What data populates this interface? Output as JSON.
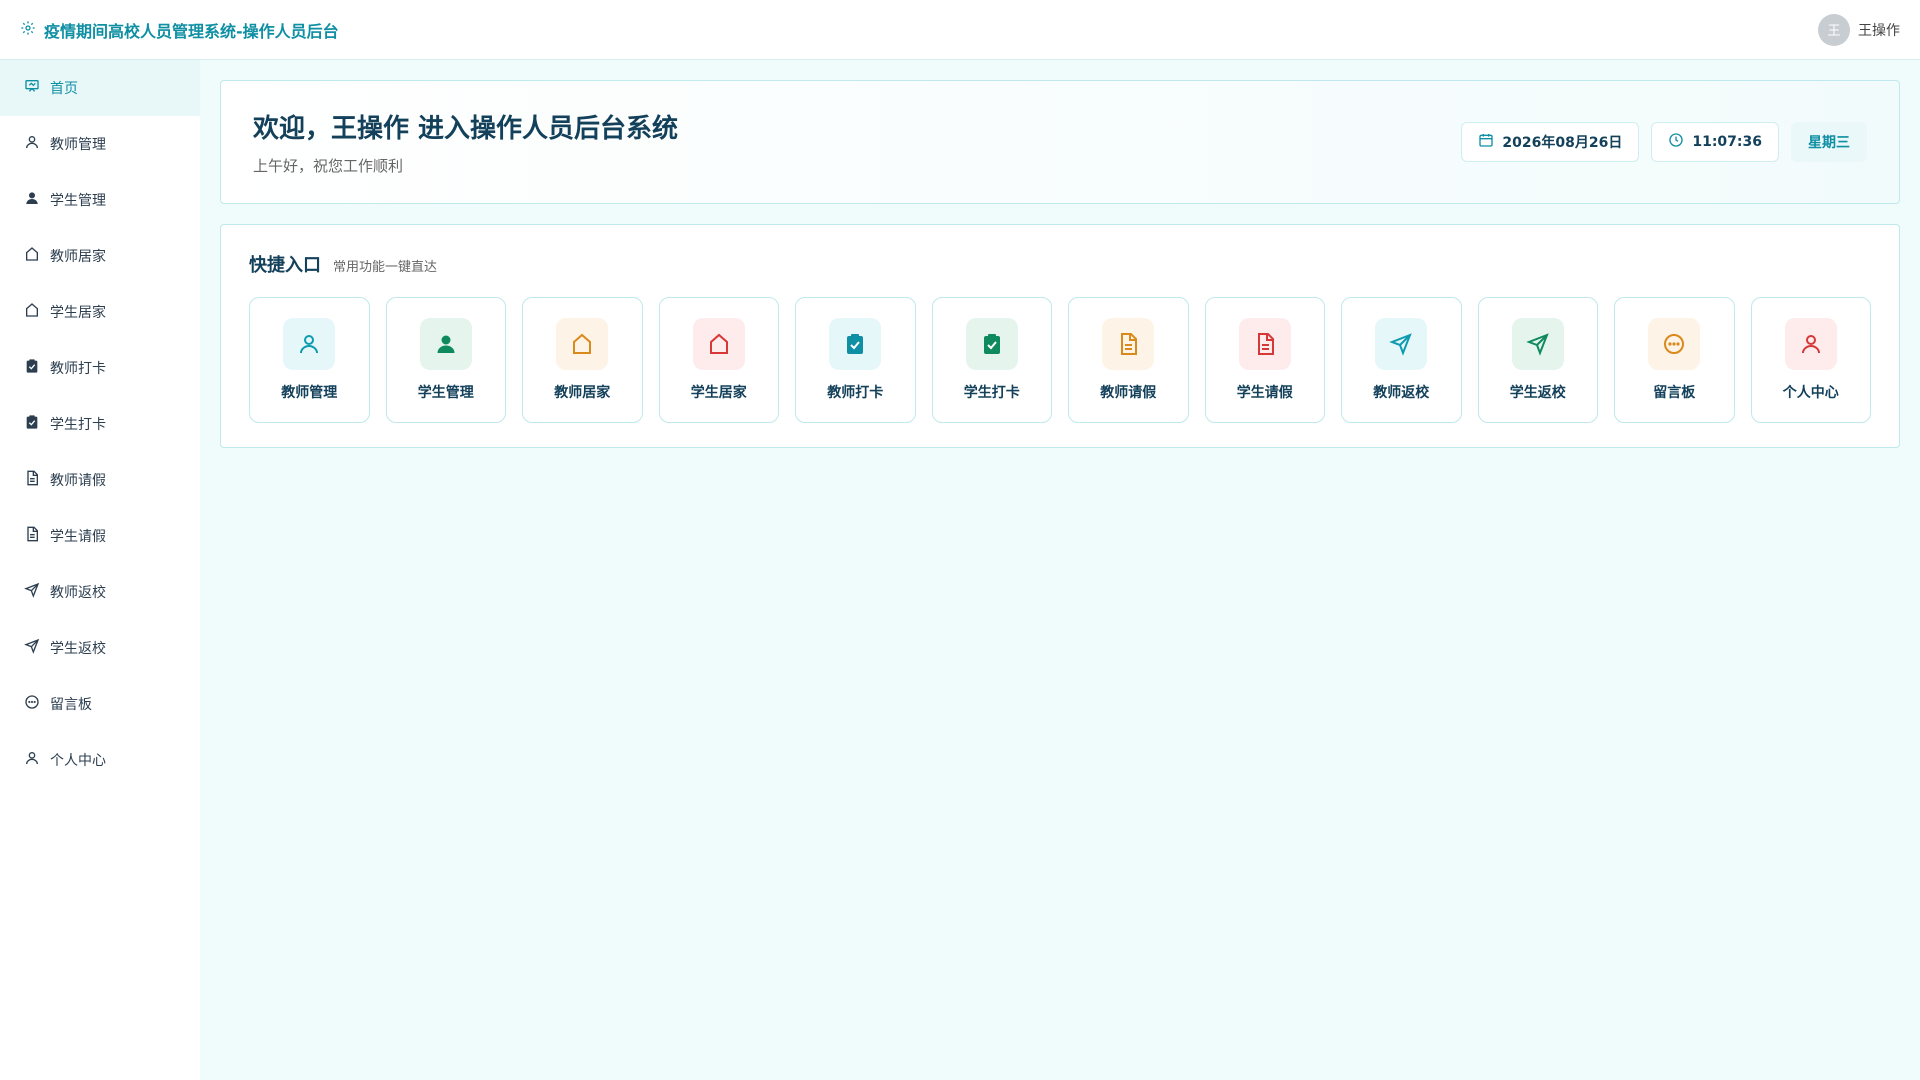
{
  "header": {
    "title": "疫情期间高校人员管理系统-操作人员后台",
    "avatar_text": "王",
    "username": "王操作"
  },
  "sidebar": {
    "items": [
      {
        "label": "首页",
        "icon": "home-icon"
      },
      {
        "label": "教师管理",
        "icon": "user-outline-icon"
      },
      {
        "label": "学生管理",
        "icon": "user-filled-icon"
      },
      {
        "label": "教师居家",
        "icon": "house-icon"
      },
      {
        "label": "学生居家",
        "icon": "house-icon"
      },
      {
        "label": "教师打卡",
        "icon": "clipboard-check-icon"
      },
      {
        "label": "学生打卡",
        "icon": "clipboard-check-icon"
      },
      {
        "label": "教师请假",
        "icon": "document-icon"
      },
      {
        "label": "学生请假",
        "icon": "document-icon"
      },
      {
        "label": "教师返校",
        "icon": "send-icon"
      },
      {
        "label": "学生返校",
        "icon": "send-icon"
      },
      {
        "label": "留言板",
        "icon": "chat-icon"
      },
      {
        "label": "个人中心",
        "icon": "user-outline-icon"
      }
    ]
  },
  "welcome": {
    "title": "欢迎，王操作 进入操作人员后台系统",
    "subtitle": "上午好，祝您工作顺利",
    "date": "2026年08月26日",
    "time": "11:07:36",
    "weekday": "星期三"
  },
  "quick": {
    "title": "快捷入口",
    "subtitle": "常用功能一键直达",
    "cards": [
      {
        "label": "教师管理",
        "icon": "user-outline-icon",
        "color": "#0e9bb0",
        "bg": "#e6f7f9"
      },
      {
        "label": "学生管理",
        "icon": "user-filled-icon",
        "color": "#0f8a5f",
        "bg": "#e5f5ee"
      },
      {
        "label": "教师居家",
        "icon": "house-icon",
        "color": "#d98a1a",
        "bg": "#fdf3e6"
      },
      {
        "label": "学生居家",
        "icon": "house-icon",
        "color": "#d63838",
        "bg": "#fdeceb"
      },
      {
        "label": "教师打卡",
        "icon": "clipboard-check-icon",
        "color": "#0e8fa3",
        "bg": "#e6f7f9"
      },
      {
        "label": "学生打卡",
        "icon": "clipboard-check-icon",
        "color": "#0f8a5f",
        "bg": "#e5f5ee"
      },
      {
        "label": "教师请假",
        "icon": "document-icon",
        "color": "#d98a1a",
        "bg": "#fdf3e6"
      },
      {
        "label": "学生请假",
        "icon": "document-icon",
        "color": "#d63838",
        "bg": "#fdeceb"
      },
      {
        "label": "教师返校",
        "icon": "send-icon",
        "color": "#0e9bb0",
        "bg": "#e6f7f9"
      },
      {
        "label": "学生返校",
        "icon": "send-icon",
        "color": "#0f8a5f",
        "bg": "#e5f5ee"
      },
      {
        "label": "留言板",
        "icon": "chat-icon",
        "color": "#d98a1a",
        "bg": "#fdf3e6"
      },
      {
        "label": "个人中心",
        "icon": "user-outline-icon",
        "color": "#d63838",
        "bg": "#fdeceb"
      }
    ]
  },
  "colors": {
    "accent": "#0e8fa3",
    "title": "#13405a",
    "background": "#f0fbfb"
  }
}
